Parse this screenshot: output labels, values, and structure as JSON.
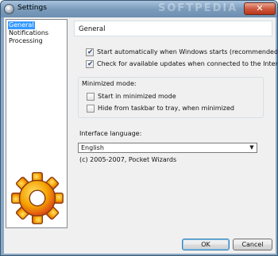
{
  "window": {
    "title": "Settings",
    "close_glyph": "✕",
    "watermark": "SOFTPEDIA"
  },
  "nav": {
    "items": [
      {
        "label": "General",
        "selected": true
      },
      {
        "label": "Notifications",
        "selected": false
      },
      {
        "label": "Processing",
        "selected": false
      }
    ],
    "logo_icon": "gear-logo-icon"
  },
  "panel": {
    "header": "General",
    "startup": {
      "start_automatically": {
        "label": "Start automatically when Windows starts (recommended)",
        "checked": true
      },
      "check_updates": {
        "label": "Check for available updates when connected to the Internet",
        "checked": true
      }
    },
    "minimized": {
      "title": "Minimized mode:",
      "start_minimized": {
        "label": "Start in minimized mode",
        "checked": false
      },
      "hide_taskbar": {
        "label": "Hide from taskbar to tray, when minimized",
        "checked": false
      }
    },
    "language": {
      "title": "Interface language:",
      "selected": "English",
      "copyright": "(c) 2005-2007, Pocket Wizards"
    }
  },
  "buttons": {
    "ok": "OK",
    "cancel": "Cancel"
  },
  "colors": {
    "selection": "#3399ff",
    "titlebar": "#7b9cbc",
    "gear_orange": "#f5a300",
    "gear_red": "#d93a1a",
    "close": "#cf5a3f"
  }
}
